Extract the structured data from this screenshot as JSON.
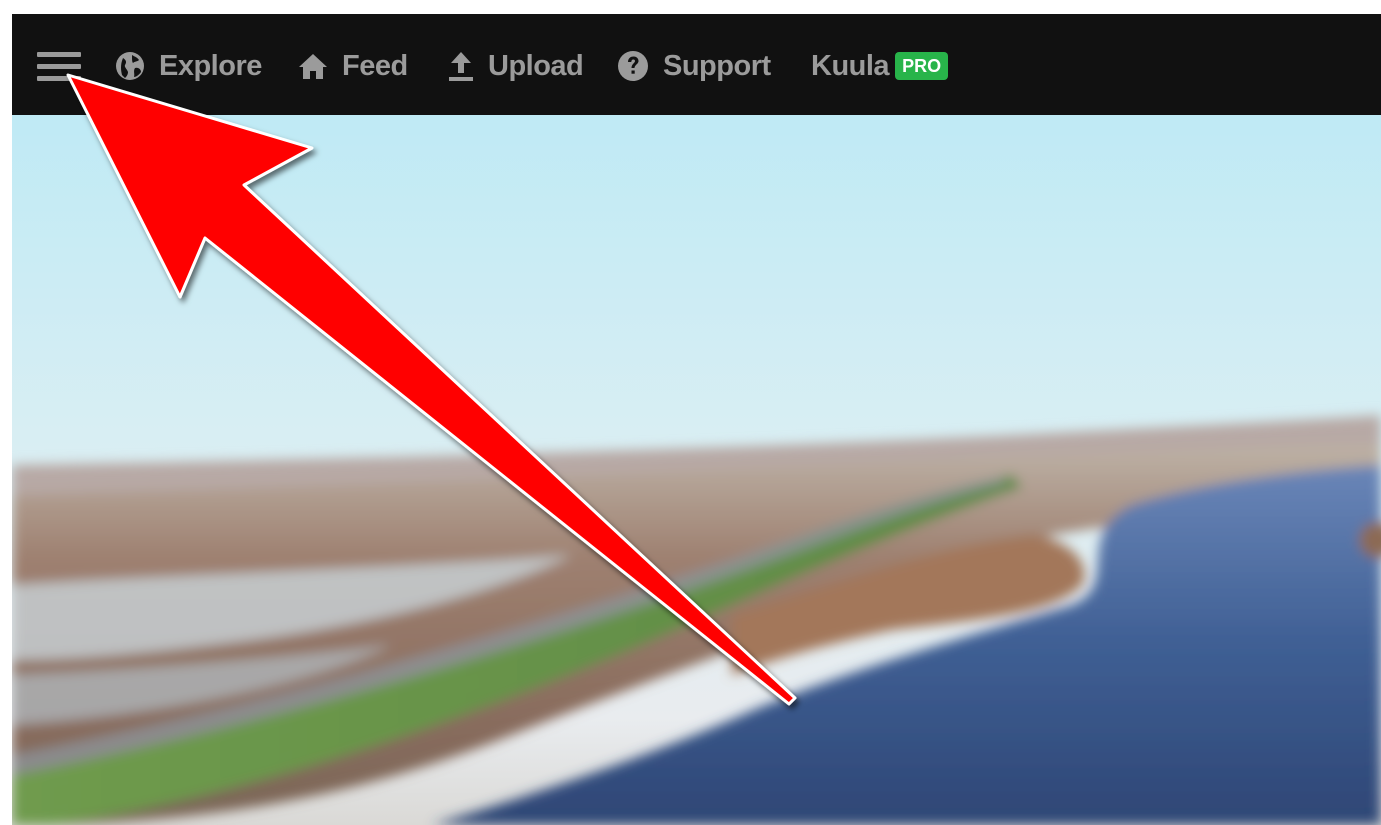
{
  "navbar": {
    "menu_icon": "hamburger-menu-icon",
    "items": [
      {
        "label": "Explore",
        "icon": "globe-icon"
      },
      {
        "label": "Feed",
        "icon": "home-icon"
      },
      {
        "label": "Upload",
        "icon": "upload-icon"
      },
      {
        "label": "Support",
        "icon": "help-circle-icon"
      },
      {
        "label": "Kuula",
        "icon": ""
      }
    ],
    "badge": "PRO",
    "colors": {
      "background": "#111111",
      "text": "#9b9b9b",
      "badge": "#28b44a"
    }
  },
  "hero": {
    "description_icon": "panorama-image"
  },
  "annotation": {
    "icon": "red-arrow-pointer",
    "color": "#ff0000"
  }
}
